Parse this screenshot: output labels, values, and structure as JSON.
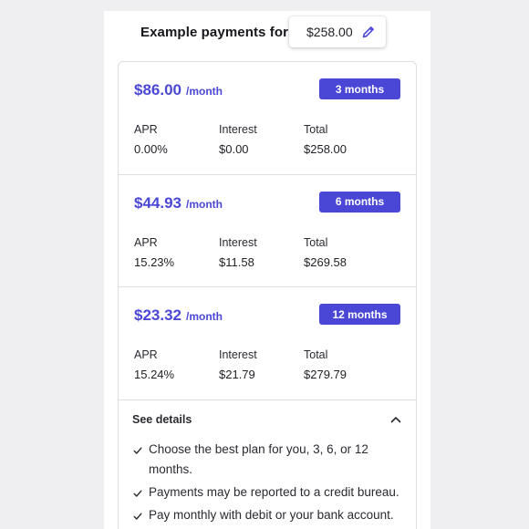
{
  "header": {
    "title": "Example payments for",
    "amount": "$258.00",
    "edit_icon": "pencil-icon"
  },
  "plans": [
    {
      "monthly": "$86.00",
      "per": "/month",
      "term": "3 months",
      "apr_label": "APR",
      "apr": "0.00%",
      "interest_label": "Interest",
      "interest": "$0.00",
      "total_label": "Total",
      "total": "$258.00"
    },
    {
      "monthly": "$44.93",
      "per": "/month",
      "term": "6 months",
      "apr_label": "APR",
      "apr": "15.23%",
      "interest_label": "Interest",
      "interest": "$11.58",
      "total_label": "Total",
      "total": "$269.58"
    },
    {
      "monthly": "$23.32",
      "per": "/month",
      "term": "12 months",
      "apr_label": "APR",
      "apr": "15.24%",
      "interest_label": "Interest",
      "interest": "$21.79",
      "total_label": "Total",
      "total": "$279.79"
    }
  ],
  "details": {
    "label": "See details",
    "toggle_icon": "chevron-up-icon",
    "bullets": [
      "Choose the best plan for you, 3, 6, or 12 months.",
      "Payments may be reported to a credit bureau.",
      "Pay monthly with debit or your bank account."
    ]
  },
  "colors": {
    "accent": "#4b47d6",
    "background": "#efeff1",
    "border": "#dedee3"
  }
}
